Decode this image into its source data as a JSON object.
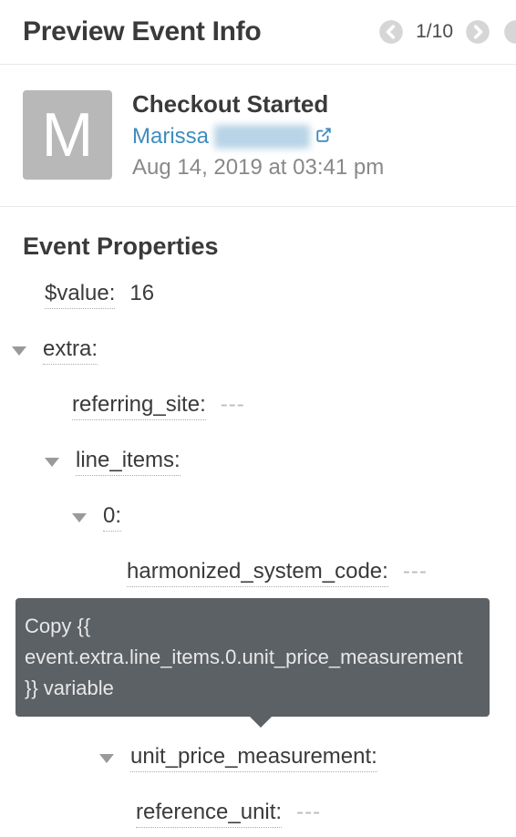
{
  "header": {
    "title": "Preview Event Info",
    "pager": "1/10"
  },
  "event": {
    "avatar_initial": "M",
    "name": "Checkout Started",
    "user_first": "Marissa",
    "timestamp": "Aug 14, 2019 at 03:41 pm"
  },
  "props": {
    "section_title": "Event Properties",
    "value_key": "$value:",
    "value_val": "16",
    "extra_key": "extra:",
    "referring_site_key": "referring_site:",
    "referring_site_val": "---",
    "line_items_key": "line_items:",
    "idx0_key": "0:",
    "hsc_key": "harmonized_system_code:",
    "hsc_val": "---",
    "upm_key": "unit_price_measurement:",
    "ref_unit_key": "reference_unit:",
    "ref_unit_val": "---"
  },
  "tooltip": {
    "text": "Copy {{ event.extra.line_items.0.unit_price_measurement }} variable"
  }
}
